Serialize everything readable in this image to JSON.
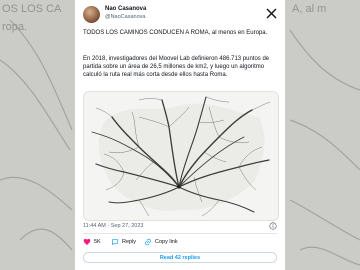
{
  "tweet": {
    "author_name": "Nao Casanova",
    "author_handle": "@NaoCasanova",
    "paragraph_1": "TODOS LOS CAMINOS CONDUCEN A ROMA, al menos en Europa.",
    "paragraph_2": "En 2018, investigadores del Moovel Lab definieron 486.713 puntos de partida sobre un área de 26,5 millones de km2, y luego un algoritmo calculó la ruta real más corta desde ellos hasta Roma.",
    "timestamp": "11:44 AM · Sep 27, 2023",
    "likes": "5K",
    "reply_label": "Reply",
    "copy_link_label": "Copy link",
    "read_replies_label": "Read 42 replies"
  },
  "colors": {
    "accent": "#1d9bf0",
    "like": "#f91880",
    "text": "#0f1419",
    "muted": "#536471"
  },
  "icons": [
    "x-logo-icon",
    "info-icon",
    "heart-icon",
    "reply-icon",
    "link-icon"
  ]
}
